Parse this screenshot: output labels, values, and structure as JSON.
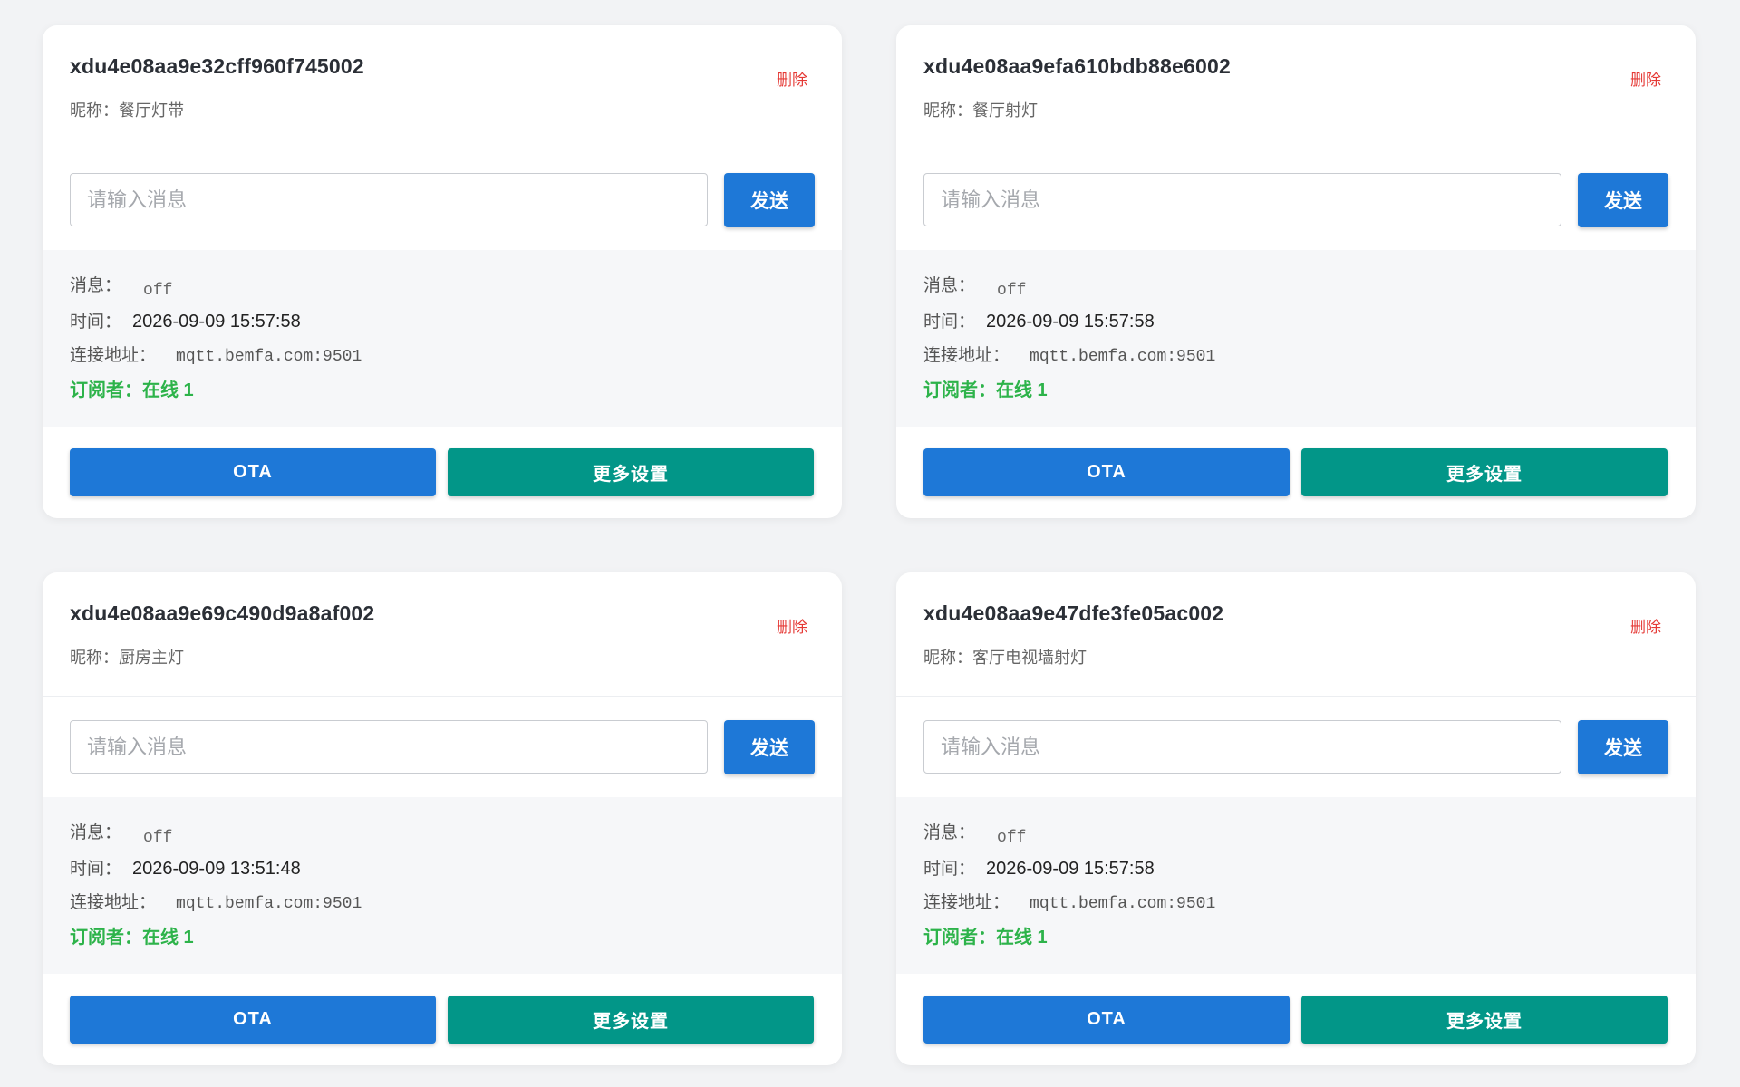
{
  "labels": {
    "nickname_prefix": "昵称：",
    "delete": "删除",
    "input_placeholder": "请输入消息",
    "send": "发送",
    "message": "消息：",
    "time": "时间：",
    "address": "连接地址：",
    "subscribers": "订阅者：",
    "ota": "OTA",
    "more_settings": "更多设置"
  },
  "devices": [
    {
      "id": "xdu4e08aa9e32cff960f745002",
      "nickname": "餐厅灯带",
      "message": "off",
      "time": "2026-09-09 15:57:58",
      "address": "mqtt.bemfa.com:9501",
      "subscribers": "在线 1"
    },
    {
      "id": "xdu4e08aa9efa610bdb88e6002",
      "nickname": "餐厅射灯",
      "message": "off",
      "time": "2026-09-09 15:57:58",
      "address": "mqtt.bemfa.com:9501",
      "subscribers": "在线 1"
    },
    {
      "id": "xdu4e08aa9e69c490d9a8af002",
      "nickname": "厨房主灯",
      "message": "off",
      "time": "2026-09-09 13:51:48",
      "address": "mqtt.bemfa.com:9501",
      "subscribers": "在线 1"
    },
    {
      "id": "xdu4e08aa9e47dfe3fe05ac002",
      "nickname": "客厅电视墙射灯",
      "message": "off",
      "time": "2026-09-09 15:57:58",
      "address": "mqtt.bemfa.com:9501",
      "subscribers": "在线 1"
    }
  ],
  "colors": {
    "primary": "#1e78d7",
    "teal": "#029688",
    "danger": "#e53935",
    "online": "#2db34a"
  }
}
